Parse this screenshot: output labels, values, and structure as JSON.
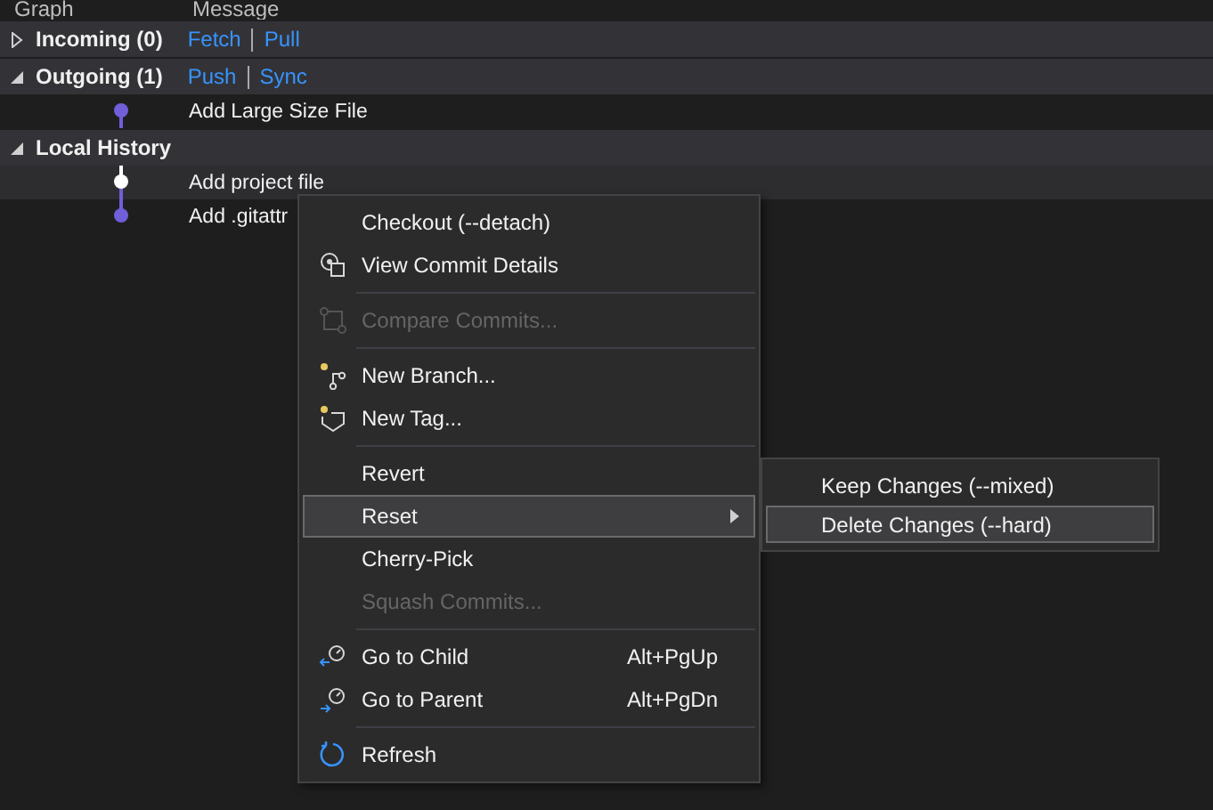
{
  "columns": [
    "Graph",
    "Message"
  ],
  "sections": [
    {
      "title": "Incoming (0)",
      "expanded": false,
      "actions": [
        "Fetch",
        "Pull"
      ]
    },
    {
      "title": "Outgoing (1)",
      "expanded": true,
      "actions": [
        "Push",
        "Sync"
      ],
      "commits": [
        {
          "message": "Add Large Size File",
          "selected": false,
          "color": "#6f5fd8"
        }
      ]
    },
    {
      "title": "Local History",
      "expanded": true,
      "commits": [
        {
          "message": "Add project file",
          "selected": true,
          "color": "#ffffff"
        },
        {
          "message": "Add .gitattr",
          "selected": false,
          "color": "#6f5fd8"
        }
      ]
    }
  ],
  "context_menu": {
    "items": [
      {
        "kind": "item",
        "label": "Checkout (--detach)",
        "disabled": false,
        "highlighted": false,
        "submenu": false
      },
      {
        "kind": "item",
        "label": "View Commit Details",
        "disabled": false,
        "highlighted": false,
        "submenu": false
      },
      {
        "kind": "separator"
      },
      {
        "kind": "item",
        "label": "Compare Commits...",
        "disabled": true,
        "highlighted": false,
        "submenu": false
      },
      {
        "kind": "separator"
      },
      {
        "kind": "item",
        "label": "New Branch...",
        "disabled": false,
        "highlighted": false,
        "submenu": false
      },
      {
        "kind": "item",
        "label": "New Tag...",
        "disabled": false,
        "highlighted": false,
        "submenu": false
      },
      {
        "kind": "separator"
      },
      {
        "kind": "item",
        "label": "Revert",
        "disabled": false,
        "highlighted": false,
        "submenu": false
      },
      {
        "kind": "item",
        "label": "Reset",
        "disabled": false,
        "highlighted": true,
        "submenu": true
      },
      {
        "kind": "item",
        "label": "Cherry-Pick",
        "disabled": false,
        "highlighted": false,
        "submenu": false
      },
      {
        "kind": "item",
        "label": "Squash Commits...",
        "disabled": true,
        "highlighted": false,
        "submenu": false
      },
      {
        "kind": "separator"
      },
      {
        "kind": "item",
        "label": "Go to Child",
        "shortcut": "Alt+PgUp",
        "disabled": false,
        "highlighted": false,
        "submenu": false
      },
      {
        "kind": "item",
        "label": "Go to Parent",
        "shortcut": "Alt+PgDn",
        "disabled": false,
        "highlighted": false,
        "submenu": false
      },
      {
        "kind": "separator"
      },
      {
        "kind": "item",
        "label": "Refresh",
        "disabled": false,
        "highlighted": false,
        "submenu": false
      }
    ]
  },
  "submenu": {
    "items": [
      {
        "label": "Keep Changes (--mixed)",
        "highlighted": false
      },
      {
        "label": "Delete Changes (--hard)",
        "highlighted": true
      }
    ]
  }
}
